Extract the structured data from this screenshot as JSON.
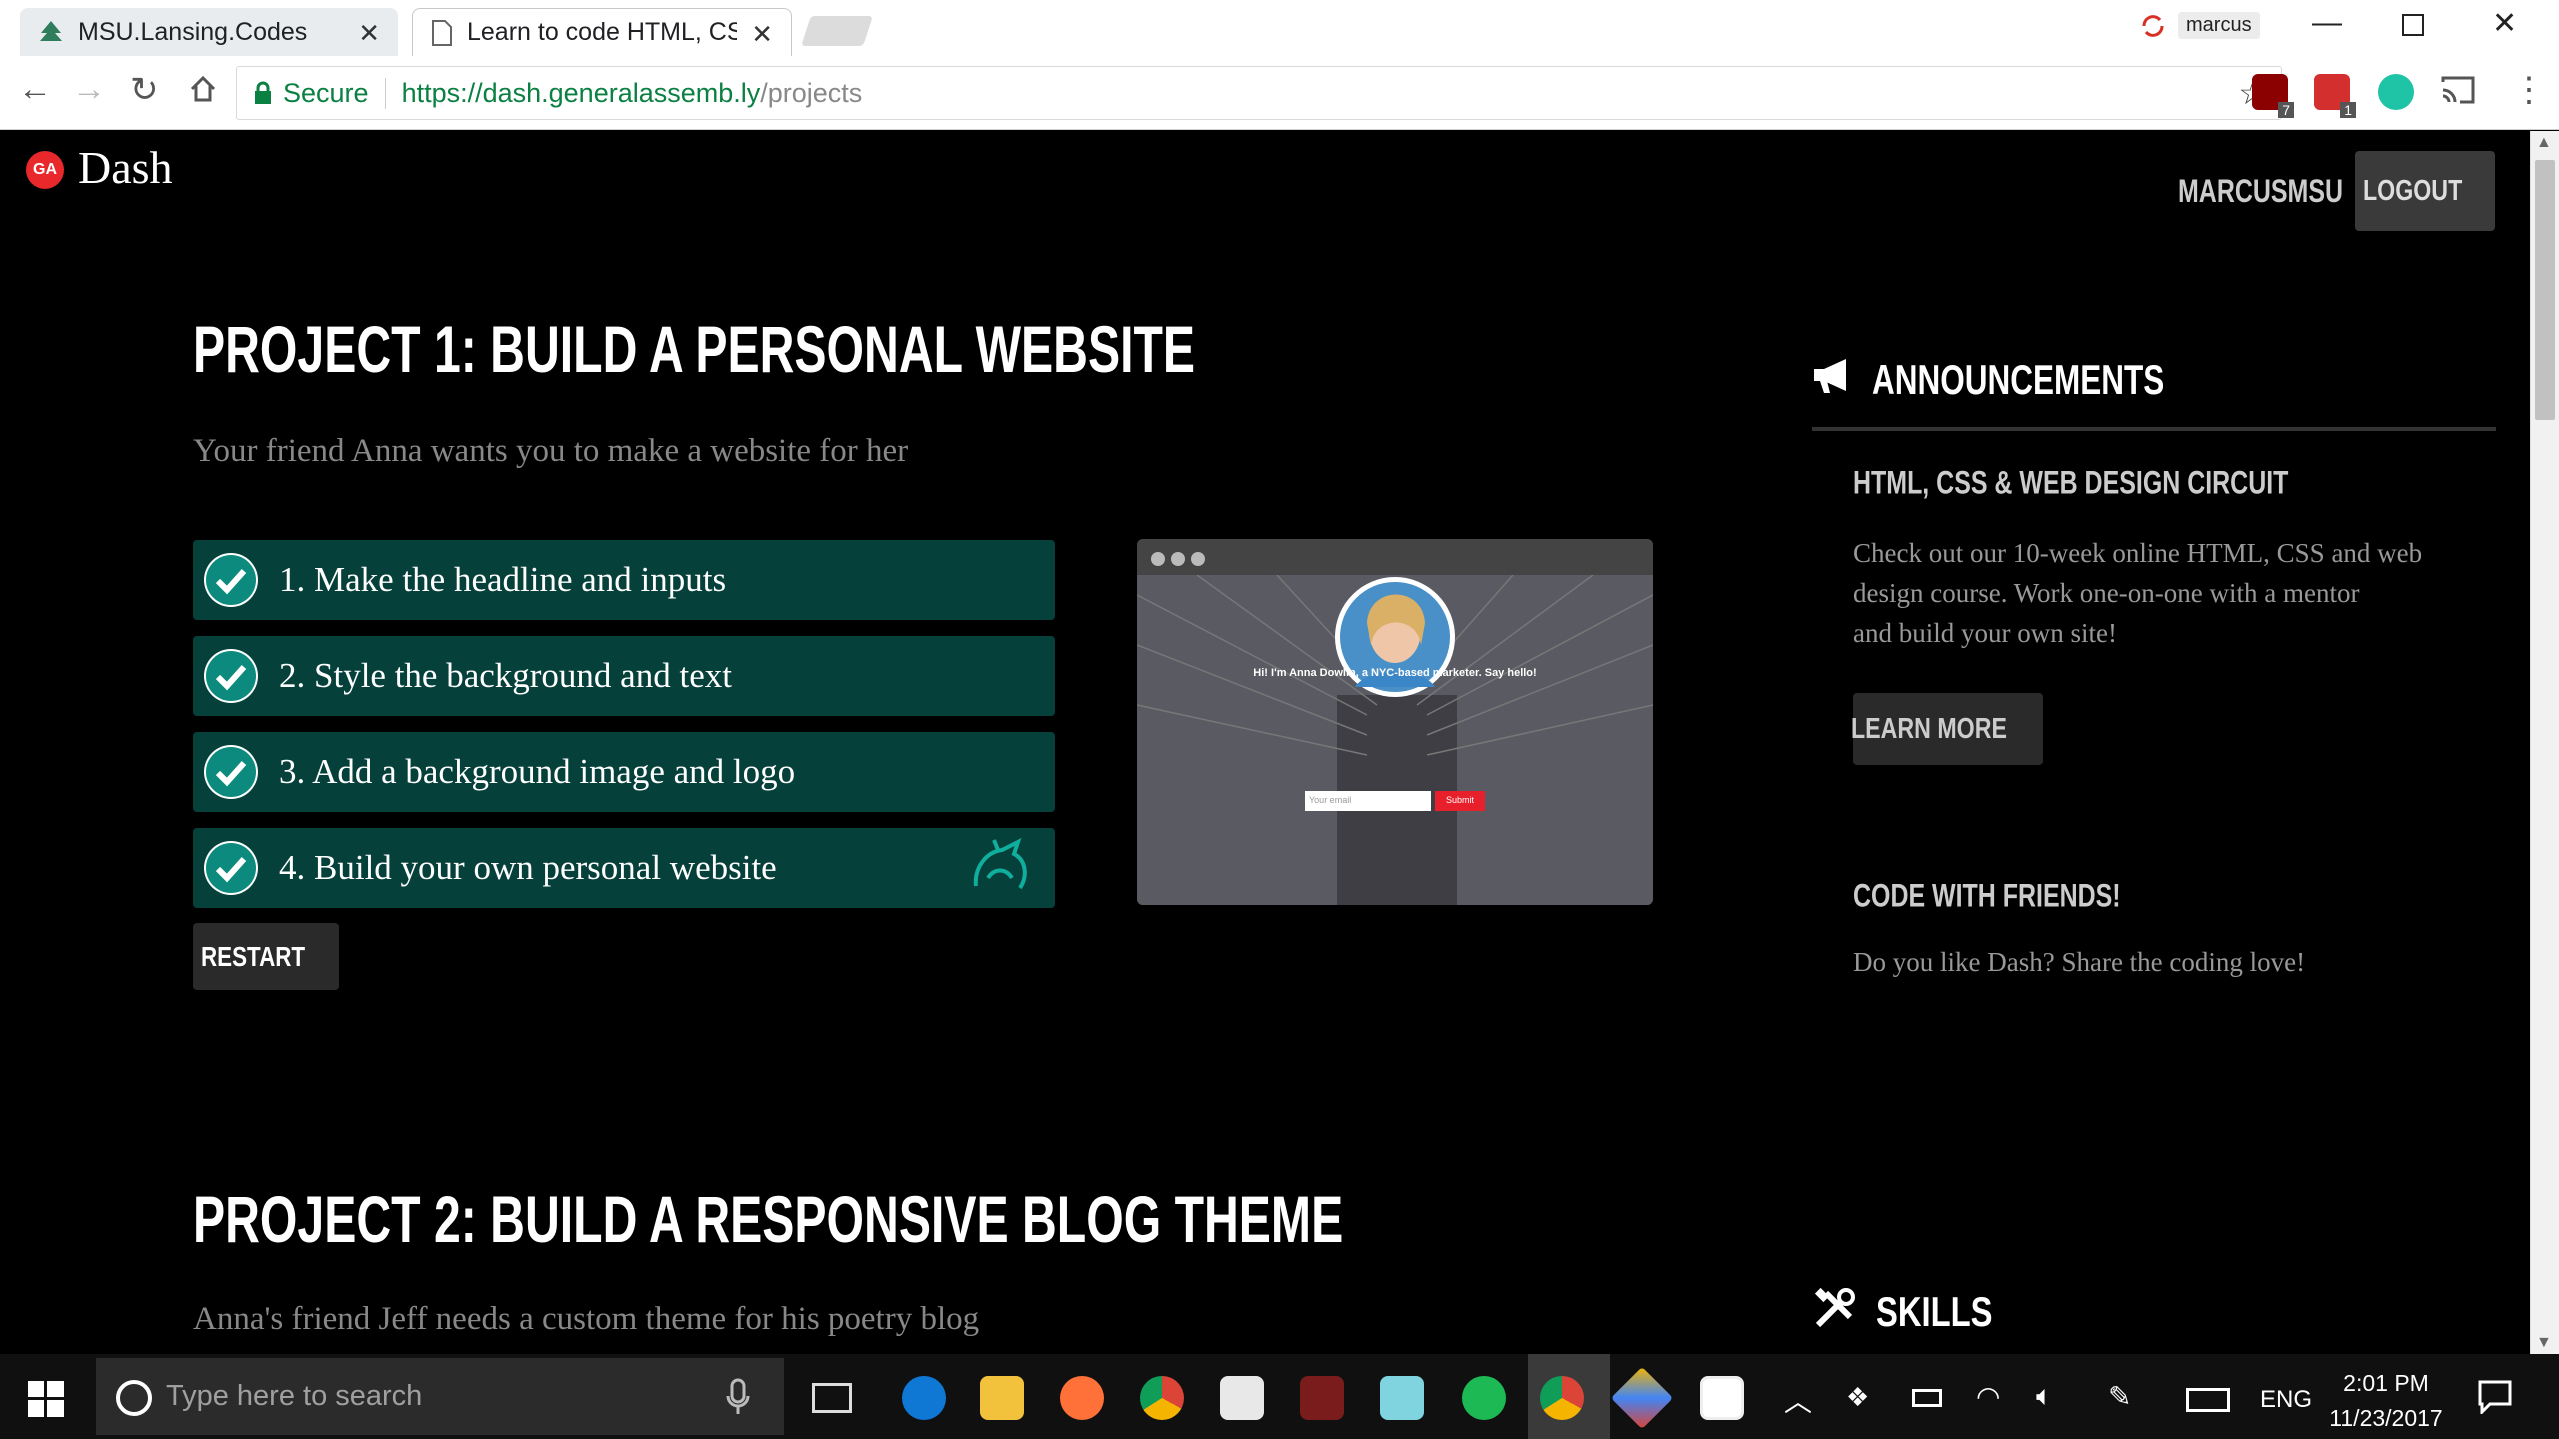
{
  "browser": {
    "tabs": [
      {
        "title": "MSU.Lansing.Codes",
        "active": false
      },
      {
        "title": "Learn to code HTML, CSS",
        "active": true
      }
    ],
    "profile_name": "marcus",
    "security_label": "Secure",
    "url_host": "https://dash.generalassemb.ly",
    "url_path": "/projects",
    "extension_badges": [
      "7",
      "1"
    ]
  },
  "header": {
    "logo_badge": "GA",
    "logo_text": "Dash",
    "username": "MARCUSMSU",
    "logout_label": "LOGOUT"
  },
  "project1": {
    "title": "PROJECT 1: BUILD A PERSONAL WEBSITE",
    "subtitle": "Your friend Anna wants you to make a website for her",
    "steps": [
      {
        "label": "1. Make the headline and inputs",
        "done": true
      },
      {
        "label": "2. Style the background and text",
        "done": true
      },
      {
        "label": "3. Add a background image and logo",
        "done": true
      },
      {
        "label": "4. Build your own personal website",
        "done": true
      }
    ],
    "restart_label": "RESTART",
    "preview": {
      "headline": "Hi! I'm Anna Dowlin, a NYC-based marketer. Say hello!",
      "email_placeholder": "Your email",
      "submit_label": "Submit"
    }
  },
  "project2": {
    "title": "PROJECT 2: BUILD A RESPONSIVE BLOG THEME",
    "subtitle": "Anna's friend Jeff needs a custom theme for his poetry blog"
  },
  "sidebar": {
    "announcements_title": "ANNOUNCEMENTS",
    "items": [
      {
        "title": "HTML, CSS & WEB DESIGN CIRCUIT",
        "body": [
          "Check out our 10-week online HTML, CSS and web",
          "design course. Work one-on-one with a mentor",
          "and build your own site!"
        ],
        "button_label": "LEARN MORE"
      },
      {
        "title": "CODE WITH FRIENDS!",
        "body": [
          "Do you like Dash? Share the coding love!"
        ]
      }
    ],
    "skills_title": "SKILLS"
  },
  "taskbar": {
    "search_placeholder": "Type here to search",
    "language": "ENG",
    "time": "2:01 PM",
    "date": "11/23/2017"
  },
  "colors": {
    "step_bg": "#06403b",
    "check": "#0c8a7d",
    "ga_red": "#e8282b",
    "secure_green": "#0b8043"
  }
}
